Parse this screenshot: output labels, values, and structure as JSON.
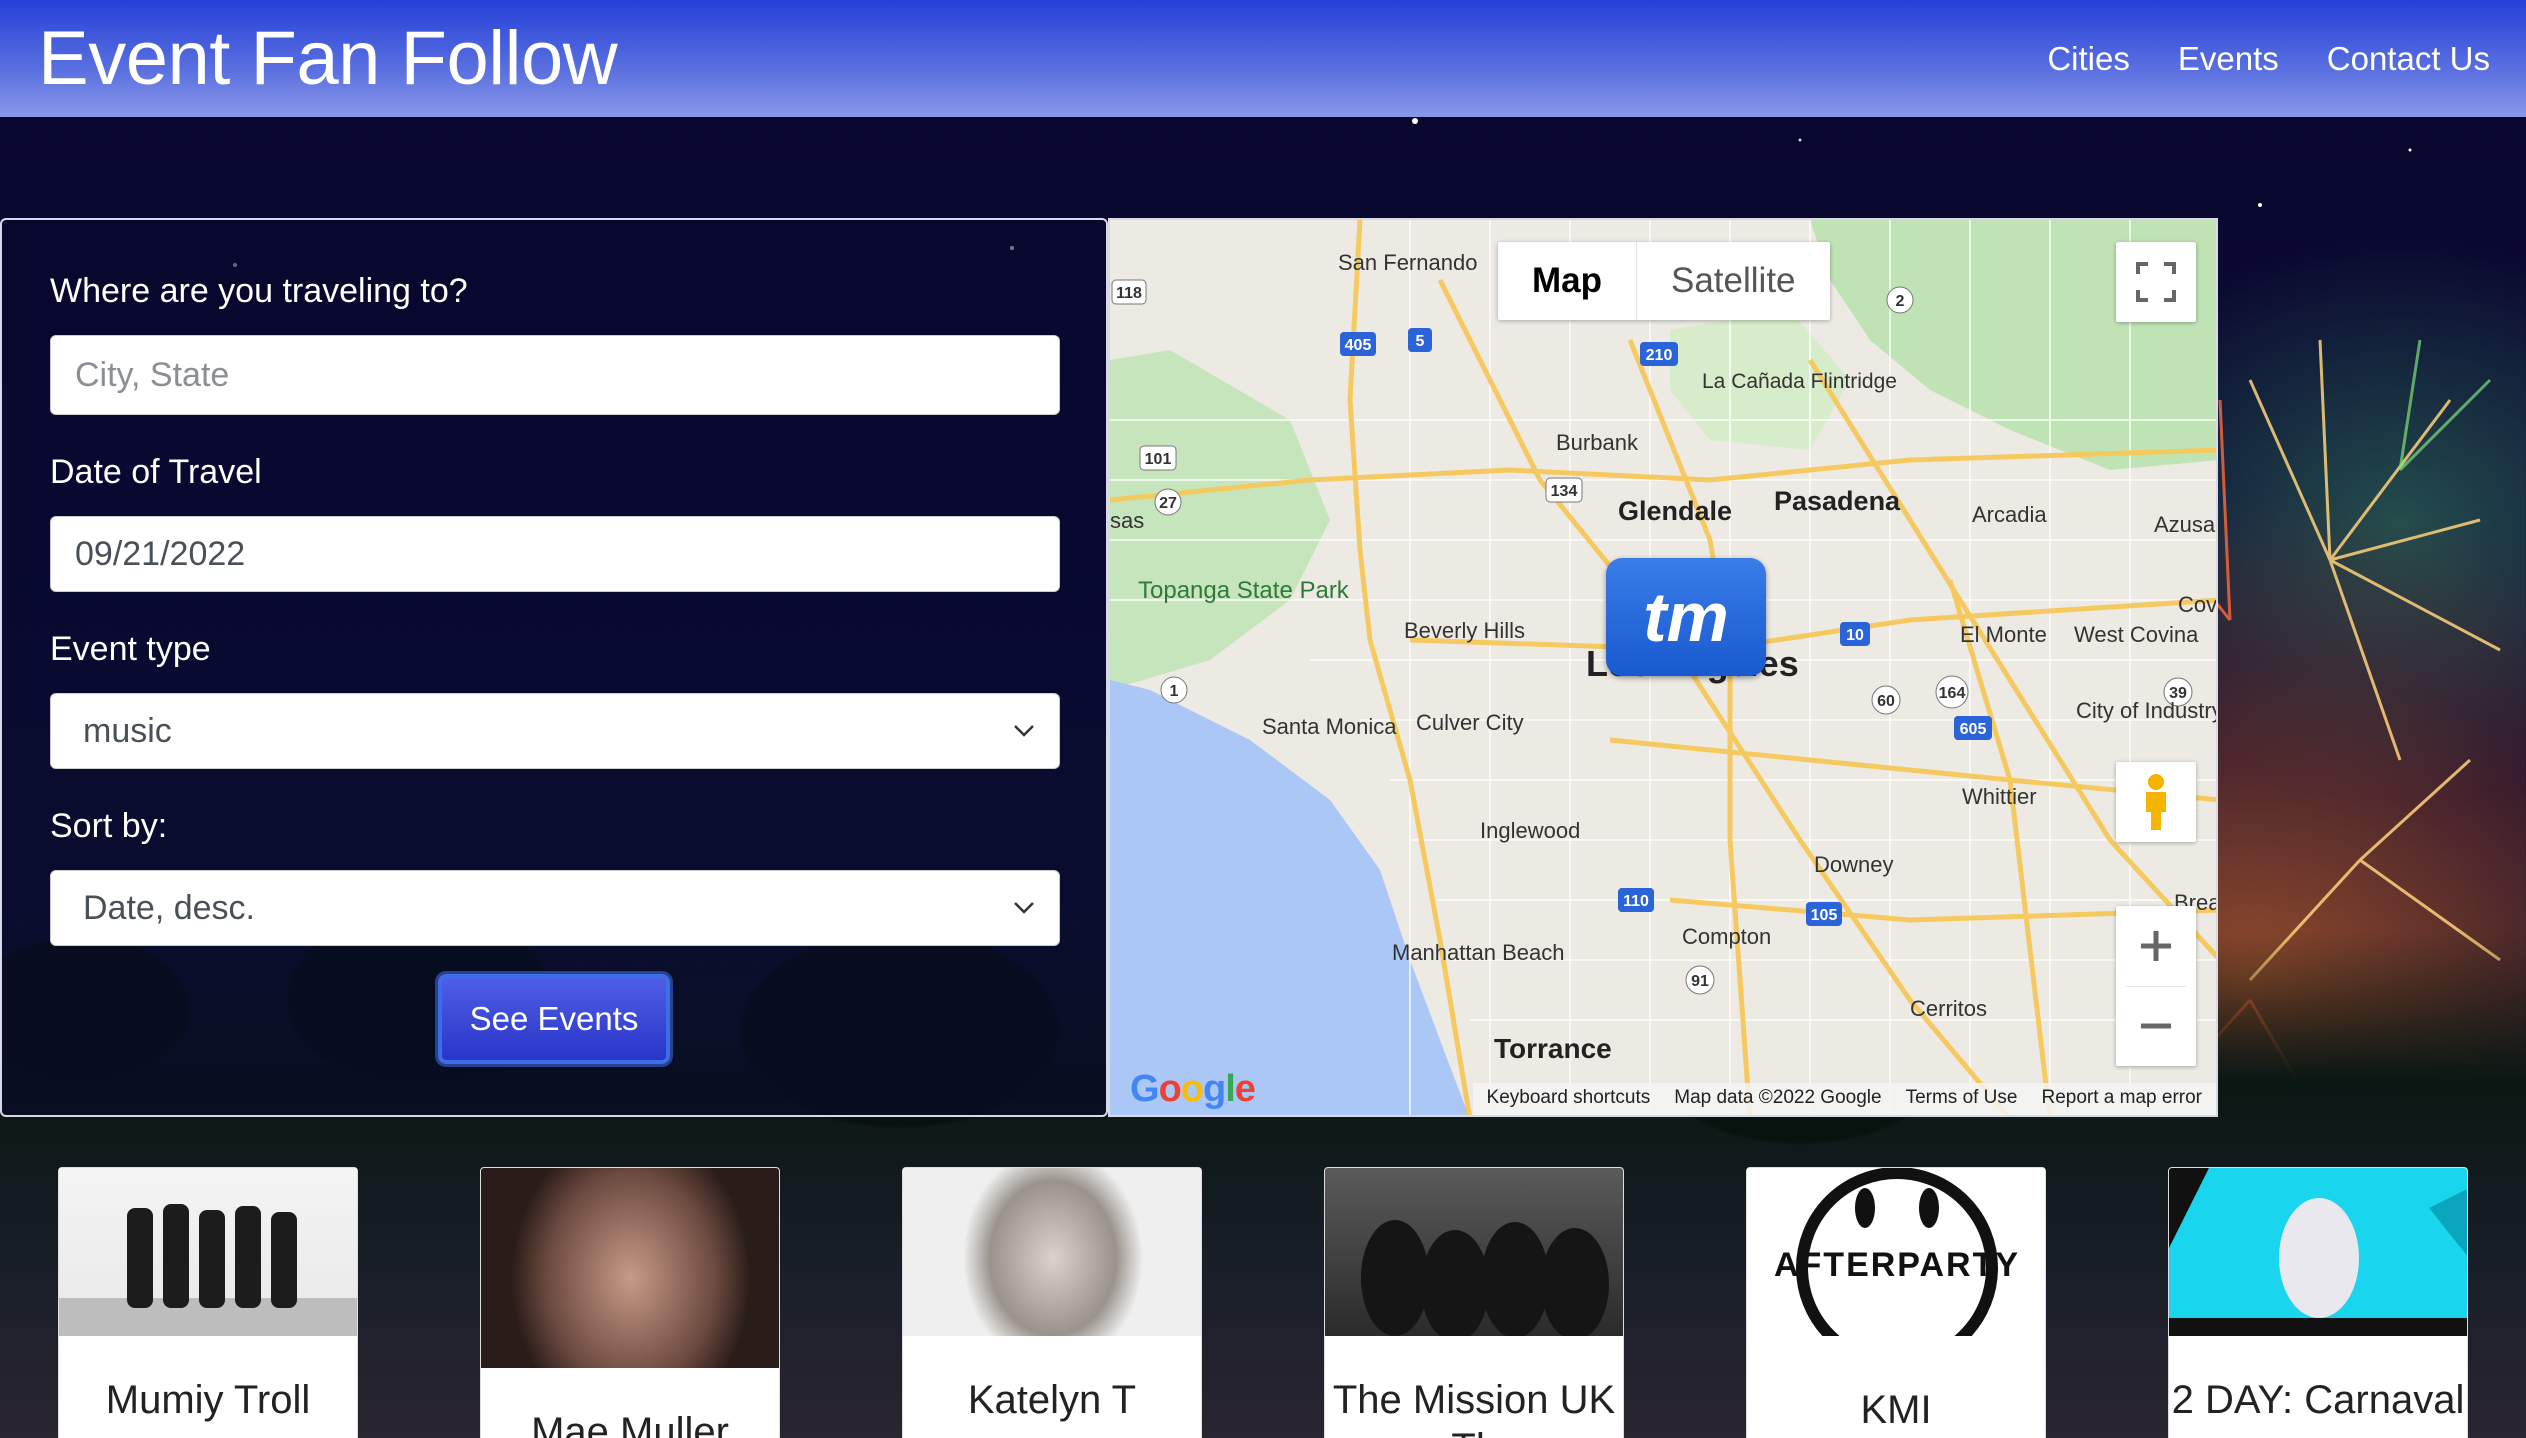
{
  "header": {
    "brand": "Event Fan Follow",
    "nav": [
      "Cities",
      "Events",
      "Contact Us"
    ]
  },
  "form": {
    "destination_label": "Where are you traveling to?",
    "destination_placeholder": "City, State",
    "date_label": "Date of Travel",
    "date_value": "09/21/2022",
    "event_type_label": "Event type",
    "event_type_value": "music",
    "sort_label": "Sort by:",
    "sort_value": "Date, desc.",
    "submit_label": "See Events"
  },
  "map": {
    "map_button": "Map",
    "satellite_button": "Satellite",
    "marker_label": "tm",
    "google_logo": "Google",
    "attribution": [
      "Keyboard shortcuts",
      "Map data ©2022 Google",
      "Terms of Use",
      "Report a map error"
    ],
    "places": [
      "San Fernando",
      "La Cañada Flintridge",
      "Burbank",
      "Glendale",
      "Pasadena",
      "Arcadia",
      "Azusa",
      "Topanga State Park",
      "Beverly Hills",
      "El Monte",
      "West Covina",
      "Santa Monica",
      "Culver City",
      "City of Industry",
      "Whittier",
      "Inglewood",
      "Downey",
      "Compton",
      "Manhattan Beach",
      "Cerritos",
      "Torrance",
      "Los Angeles",
      "Cov",
      "Brea",
      "sas"
    ],
    "highway_shields": [
      "405",
      "5",
      "210",
      "2",
      "118",
      "101",
      "134",
      "27",
      "10",
      "60",
      "164",
      "39",
      "605",
      "1",
      "110",
      "105",
      "91"
    ]
  },
  "events": [
    {
      "title": "Mumiy Troll"
    },
    {
      "title": "Mae Muller"
    },
    {
      "title": "Katelyn T"
    },
    {
      "title": "The Mission UK - The"
    },
    {
      "title": "KMI"
    },
    {
      "title": "2 DAY: Carnaval"
    }
  ],
  "colors": {
    "navbar": "#2440d8",
    "button": "#2a35c8"
  }
}
